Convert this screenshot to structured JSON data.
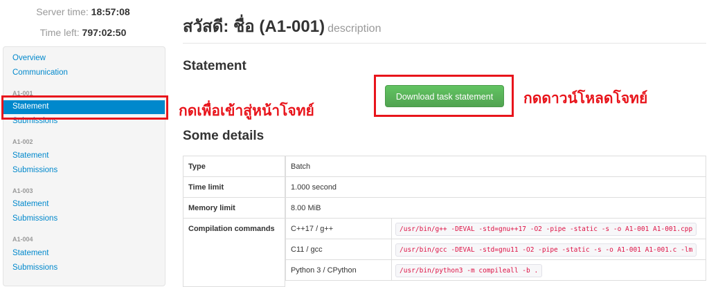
{
  "header": {
    "server_time_label": "Server time:",
    "server_time": "18:57:08",
    "time_left_label": "Time left:",
    "time_left": "797:02:50"
  },
  "sidebar": {
    "overview": "Overview",
    "communication": "Communication",
    "tasks": [
      {
        "name": "A1-001",
        "statement": "Statement",
        "submissions": "Submissions"
      },
      {
        "name": "A1-002",
        "statement": "Statement",
        "submissions": "Submissions"
      },
      {
        "name": "A1-003",
        "statement": "Statement",
        "submissions": "Submissions"
      },
      {
        "name": "A1-004",
        "statement": "Statement",
        "submissions": "Submissions"
      }
    ]
  },
  "page": {
    "title": "สวัสดี: ชื่อ (A1-001)",
    "description": "description",
    "statement_heading": "Statement",
    "download_button": "Download task statement",
    "details_heading": "Some details"
  },
  "annotations": {
    "sidebar_note": "กดเพื่อเข้าสู่หน้าโจทย์",
    "download_note": "กดดาวน์โหลดโจทย์",
    "highlight_color": "#e8141b"
  },
  "details": {
    "type_label": "Type",
    "type_value": "Batch",
    "time_limit_label": "Time limit",
    "time_limit_value": "1.000 second",
    "memory_limit_label": "Memory limit",
    "memory_limit_value": "8.00 MiB",
    "compilation_label": "Compilation commands",
    "compilers": [
      {
        "language": "C++17 / g++",
        "command": "/usr/bin/g++ -DEVAL -std=gnu++17 -O2 -pipe -static -s -o A1-001 A1-001.cpp"
      },
      {
        "language": "C11 / gcc",
        "command": "/usr/bin/gcc -DEVAL -std=gnu11 -O2 -pipe -static -s -o A1-001 A1-001.c -lm"
      },
      {
        "language": "Python 3 / CPython",
        "command": "/usr/bin/python3 -m compileall -b ."
      }
    ]
  }
}
